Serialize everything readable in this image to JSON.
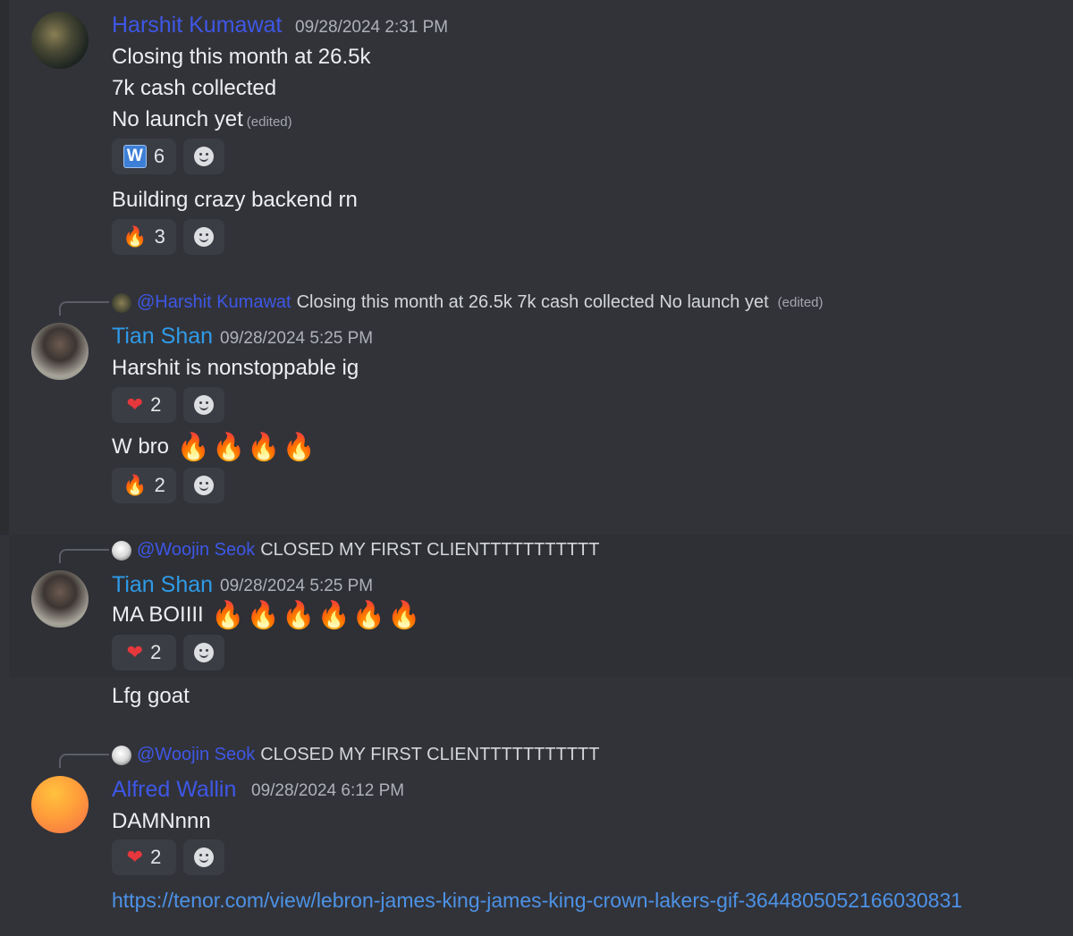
{
  "messages": [
    {
      "author": "Harshit Kumawat",
      "timestamp": "09/28/2024 2:31 PM",
      "lines": [
        "Closing this month at 26.5k",
        "7k cash collected",
        "No launch yet"
      ],
      "edited_label": "(edited)",
      "reaction_1": {
        "icon": "w-icon",
        "glyph": "W",
        "count": "6"
      },
      "followup": "Building crazy backend rn",
      "reaction_2": {
        "icon": "fire-icon",
        "count": "3"
      }
    },
    {
      "reply_to": {
        "mention": "@Harshit Kumawat",
        "text": "Closing this month at 26.5k 7k cash collected  No launch yet",
        "edited_label": "(edited)"
      },
      "author": "Tian Shan",
      "timestamp": "09/28/2024 5:25 PM",
      "text": "Harshit is nonstoppable ig",
      "reaction_1": {
        "icon": "heart-icon",
        "count": "2"
      },
      "followup": "W bro",
      "reaction_2": {
        "icon": "fire-icon",
        "count": "2"
      }
    },
    {
      "reply_to": {
        "mention": "@Woojin Seok",
        "text": "CLOSED MY FIRST CLIENTTTTTTTTTTT"
      },
      "author": "Tian Shan",
      "timestamp": "09/28/2024 5:25 PM",
      "text": "MA BOIIII",
      "reaction_1": {
        "icon": "heart-icon",
        "count": "2"
      },
      "followup": "Lfg goat"
    },
    {
      "reply_to": {
        "mention": "@Woojin Seok",
        "text": "CLOSED MY FIRST CLIENTTTTTTTTTTT"
      },
      "author": "Alfred Wallin",
      "timestamp": "09/28/2024 6:12 PM",
      "text": "DAMNnnn",
      "reaction_1": {
        "icon": "heart-icon",
        "count": "2"
      },
      "link": "https://tenor.com/view/lebron-james-king-james-king-crown-lakers-gif-3644805052166030831"
    }
  ],
  "glyphs": {
    "fire": "🔥",
    "heart": "❤"
  },
  "colors": {
    "background": "#323339",
    "mention": "#3e57e6",
    "author_blue": "#3e57e6",
    "author_cyan": "#2f9be8",
    "link": "#4d92e6"
  }
}
